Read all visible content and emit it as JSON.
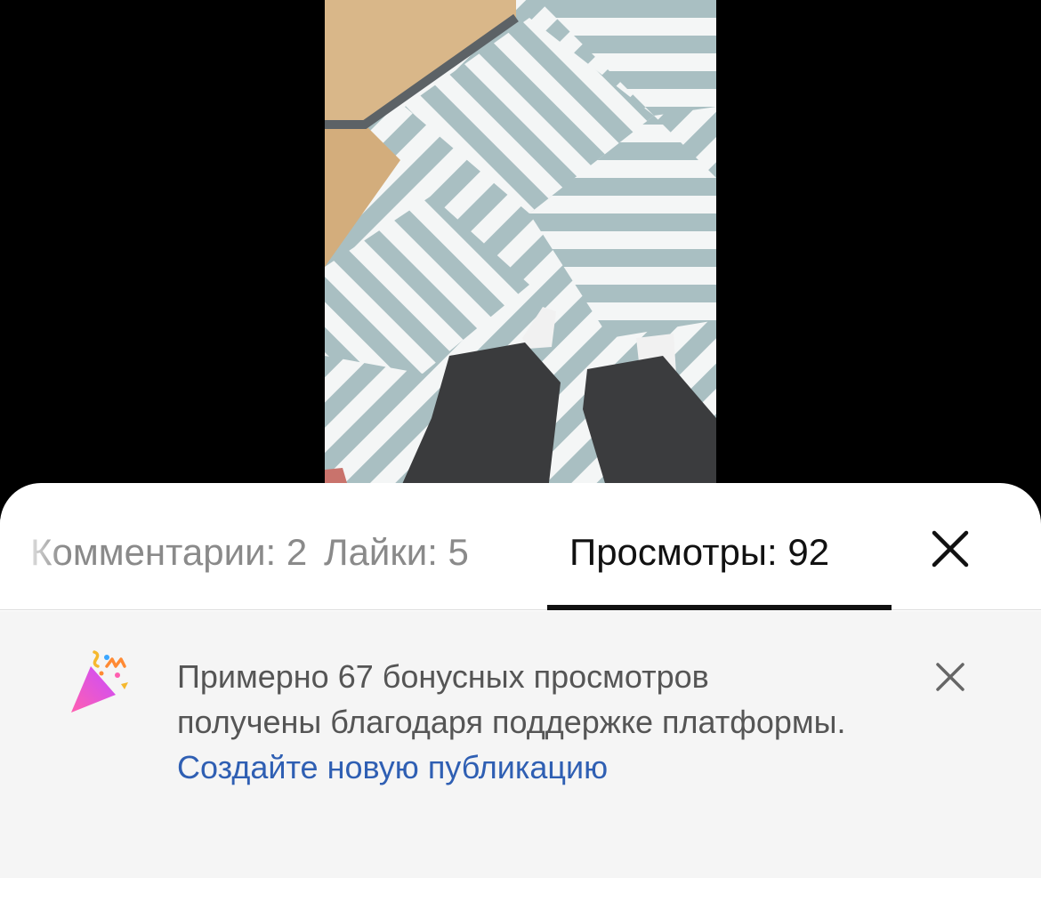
{
  "tabs": {
    "comments_label": "Комментарии: 2",
    "likes_label": "Лайки: 5",
    "views_label": "Просмотры: 92",
    "active_tab": "views"
  },
  "banner": {
    "text": "Примерно 67 бонусных просмотров получены благодаря поддержке платформы.",
    "link_text": "Создайте новую публикацию",
    "icon": "party-popper-icon"
  },
  "icons": {
    "close_sheet": "close-icon",
    "close_banner": "close-icon"
  },
  "colors": {
    "active_tab": "#111111",
    "inactive_tab": "#8a8a8a",
    "link": "#2f5fb3",
    "banner_bg": "#f5f5f5"
  }
}
